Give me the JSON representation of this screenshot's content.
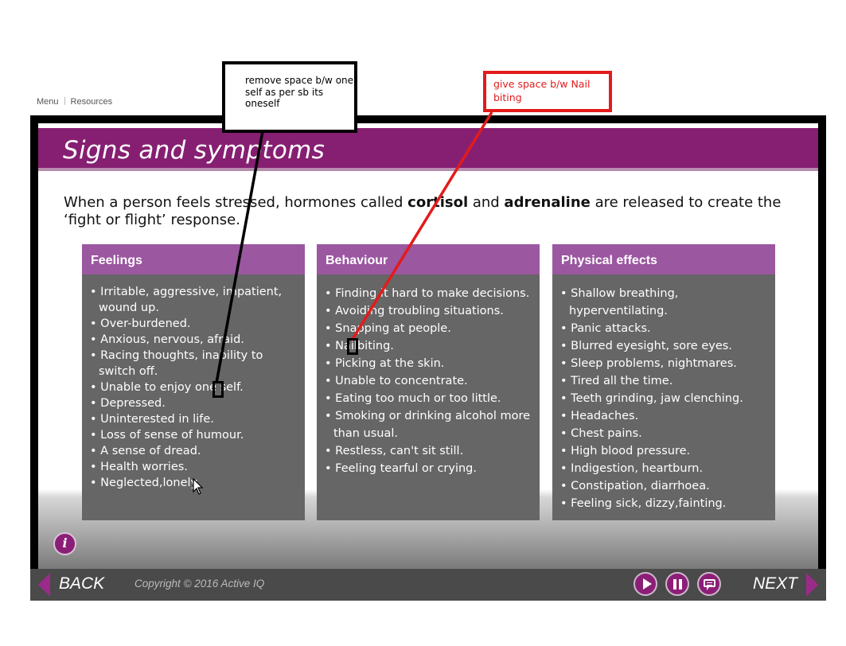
{
  "top_nav": {
    "menu": "Menu",
    "resources": "Resources"
  },
  "slide": {
    "title": "Signs and symptoms",
    "intro": {
      "part1": "When a person feels stressed, hormones called ",
      "bold1": "cortisol",
      "part2": " and ",
      "bold2": "adrenaline",
      "part3": " are released to create the ‘fight or flight’ response."
    },
    "columns": [
      {
        "heading": "Feelings",
        "items": [
          "Irritable, aggressive, impatient, wound up.",
          "Over-burdened.",
          "Anxious, nervous, afraid.",
          "Racing thoughts, inability to switch off.",
          "Unable to enjoy one self.",
          "Depressed.",
          "Uninterested in life.",
          "Loss of sense of humour.",
          "A sense of dread.",
          "Health worries.",
          "Neglected,lonely."
        ]
      },
      {
        "heading": "Behaviour",
        "items": [
          "Finding it hard to make decisions.",
          "Avoiding troubling situations.",
          "Snapping at people.",
          "Nailbiting.",
          "Picking at the skin.",
          "Unable to concentrate.",
          "Eating too much or too little.",
          "Smoking or drinking alcohol more than usual.",
          "Restless, can't sit still.",
          "Feeling tearful or crying."
        ]
      },
      {
        "heading": "Physical effects",
        "items": [
          "Shallow breathing, hyperventilating.",
          "Panic attacks.",
          "Blurred eyesight, sore eyes.",
          "Sleep problems, nightmares.",
          "Tired all the time.",
          "Teeth grinding, jaw clenching.",
          "Headaches.",
          "Chest pains.",
          "High blood pressure.",
          "Indigestion, heartburn.",
          "Constipation, diarrhoea.",
          "Feeling sick, dizzy,fainting."
        ]
      }
    ],
    "info_symbol": "i"
  },
  "footer": {
    "back_label": "BACK",
    "copyright": "Copyright © 2016 Active IQ",
    "next_label": "NEXT",
    "icons": [
      "play-icon",
      "pause-icon",
      "chat-icon"
    ]
  },
  "annotations": {
    "black_note": "remove space b/w one self as per sb its oneself",
    "red_note": "give space b/w Nail biting",
    "black_color": "#000000",
    "red_color": "#e31b1b"
  },
  "colors": {
    "brand_purple": "#861f72",
    "column_header": "#9b57a0",
    "column_body": "#666666"
  }
}
